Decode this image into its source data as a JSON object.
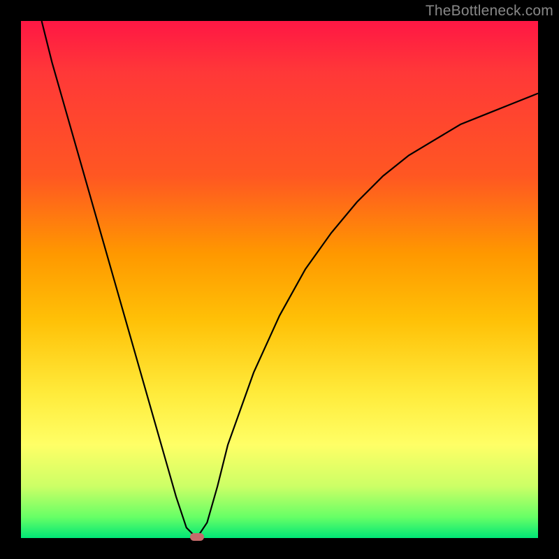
{
  "watermark": "TheBottleneck.com",
  "chart_data": {
    "type": "line",
    "title": "",
    "xlabel": "",
    "ylabel": "",
    "xlim": [
      0,
      100
    ],
    "ylim": [
      0,
      100
    ],
    "grid": false,
    "background_gradient": {
      "top": "#ff1744",
      "mid": "#ffeb3b",
      "bottom": "#00e676"
    },
    "series": [
      {
        "name": "bottleneck-curve",
        "color": "#000000",
        "x": [
          4,
          6,
          8,
          10,
          12,
          14,
          16,
          18,
          20,
          22,
          24,
          26,
          28,
          30,
          32,
          34,
          36,
          38,
          40,
          45,
          50,
          55,
          60,
          65,
          70,
          75,
          80,
          85,
          90,
          95,
          100
        ],
        "y": [
          100,
          92,
          85,
          78,
          71,
          64,
          57,
          50,
          43,
          36,
          29,
          22,
          15,
          8,
          2,
          0,
          3,
          10,
          18,
          32,
          43,
          52,
          59,
          65,
          70,
          74,
          77,
          80,
          82,
          84,
          86
        ]
      }
    ],
    "marker": {
      "name": "optimal-point",
      "x": 34,
      "y": 0,
      "color": "#c46b6b"
    }
  }
}
